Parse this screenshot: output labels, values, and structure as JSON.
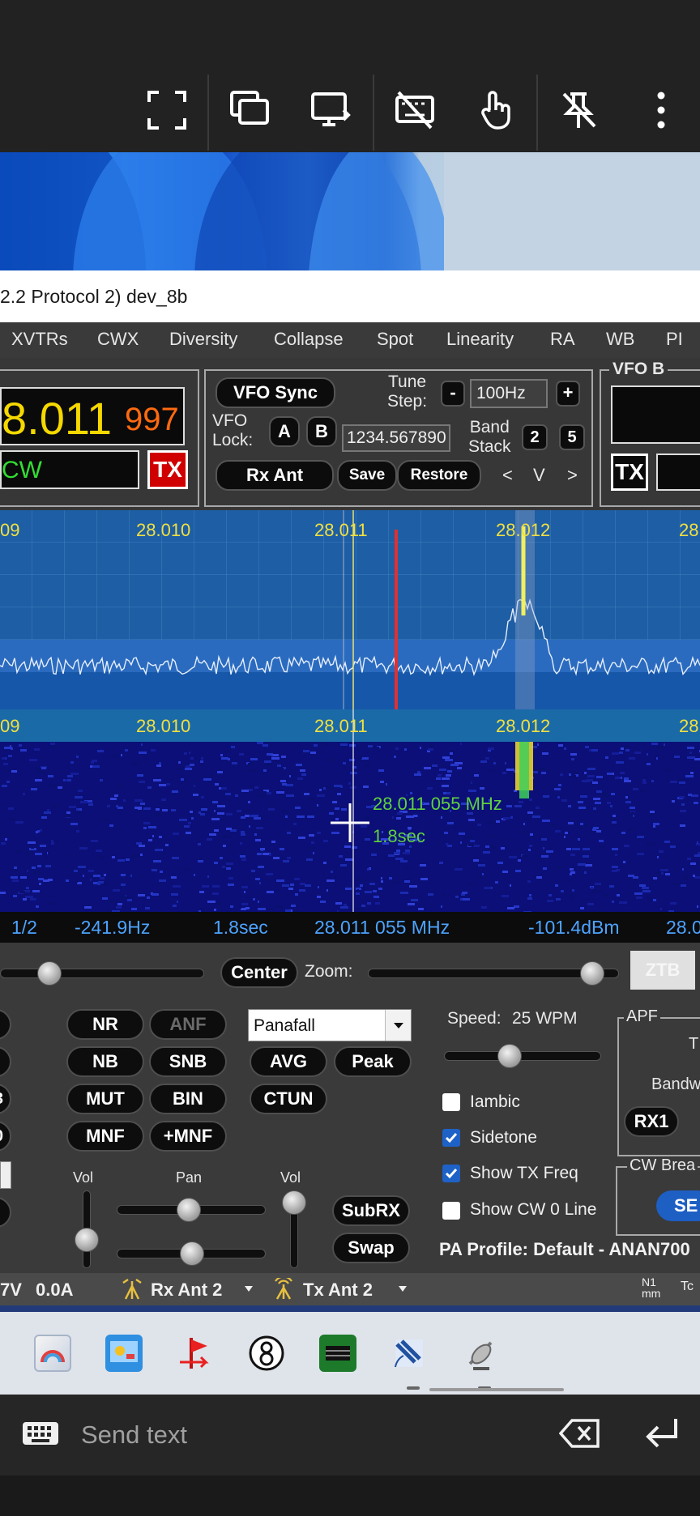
{
  "toolbar": {
    "icons": [
      "fullscreen-icon",
      "windows-icon",
      "display-switch-icon",
      "keyboard-off-icon",
      "touch-icon",
      "unpin-icon",
      "more-vert-icon"
    ]
  },
  "window": {
    "title": "2.2 Protocol 2) dev_8b"
  },
  "menu": [
    "XVTRs",
    "CWX",
    "Diversity",
    "Collapse",
    "Spot",
    "Linearity",
    "RA",
    "WB",
    "PI"
  ],
  "vfo_a": {
    "freq_main": "8.011",
    "freq_sub": "997",
    "mode": "CW",
    "tx_label": "TX"
  },
  "vfo_panel": {
    "vfo_sync": "VFO Sync",
    "vfo_lock_label": "VFO\nLock:",
    "lock_a": "A",
    "lock_b": "B",
    "tune_step_label": "Tune\nStep:",
    "tune_minus": "-",
    "tune_step_value": "100Hz",
    "tune_plus": "+",
    "memory_value": "1234.567890",
    "band_stack_label": "Band\nStack",
    "band_stack_1": "2",
    "band_stack_2": "5",
    "rx_ant": "Rx Ant",
    "save": "Save",
    "restore": "Restore",
    "nav_prev": "<",
    "nav_down": "V",
    "nav_next": ">"
  },
  "vfo_b": {
    "label": "VFO B",
    "tx_label": "TX"
  },
  "panadapter": {
    "freq_labels": [
      "09",
      "28.010",
      "28.011",
      "28.012",
      "28"
    ],
    "colors": {
      "background": "#1e5ea5",
      "waterfall": "#0b0f77",
      "cursor_line": "#e8e070",
      "marker_red": "#e03030"
    }
  },
  "waterfall": {
    "cursor_freq": "28.011 055 MHz",
    "cursor_time": "1.8sec"
  },
  "info_bar": {
    "items": [
      "1/2",
      "-241.9Hz",
      "1.8sec",
      "28.011 055 MHz",
      "-101.4dBm",
      "28.0"
    ]
  },
  "zoom_row": {
    "center": "Center",
    "zoom_label": "Zoom:",
    "ztb": "ZTB"
  },
  "dsp_buttons": {
    "nr": "NR",
    "anf": "ANF",
    "nb": "NB",
    "snb": "SNB",
    "mut": "MUT",
    "bin": "BIN",
    "mnf": "MNF",
    "plus_mnf": "+MNF"
  },
  "display": {
    "mode_select": "Panafall",
    "avg": "AVG",
    "peak": "Peak",
    "ctun": "CTUN"
  },
  "left_edge_labels": [
    "3",
    "0"
  ],
  "audio": {
    "vol_label": "Vol",
    "pan_label": "Pan",
    "vol2_label": "Vol",
    "subrx": "SubRX",
    "swap": "Swap"
  },
  "cw": {
    "speed_label": "Speed:",
    "speed_value": "25 WPM",
    "speed_level_fraction": 0.42,
    "iambic": "Iambic",
    "sidetone": "Sidetone",
    "show_tx_freq": "Show TX Freq",
    "show_cw_0_line": "Show CW 0 Line",
    "iambic_checked": false,
    "sidetone_checked": true,
    "show_tx_freq_checked": true,
    "show_cw_0_checked": false
  },
  "apf": {
    "label": "APF",
    "t_label": "T",
    "bandw_label": "Bandw",
    "rx1": "RX1",
    "cw_break_label": "CW Brea",
    "se_button": "SE"
  },
  "pa_profile": "PA Profile: Default - ANAN700",
  "status": {
    "voltage": "7V",
    "current": "0.0A",
    "rx_ant": "Rx Ant 2",
    "tx_ant": "Tx Ant 2",
    "right_a": "N1\nmm",
    "right_b": "Tc"
  },
  "taskbar": {
    "icons": [
      "photos-icon",
      "control-panel-icon",
      "flag-app-icon",
      "eight-ball-icon",
      "circuit-board-icon",
      "satellite-icon",
      "radar-icon"
    ]
  },
  "keyboard_bar": {
    "placeholder": "Send text"
  }
}
